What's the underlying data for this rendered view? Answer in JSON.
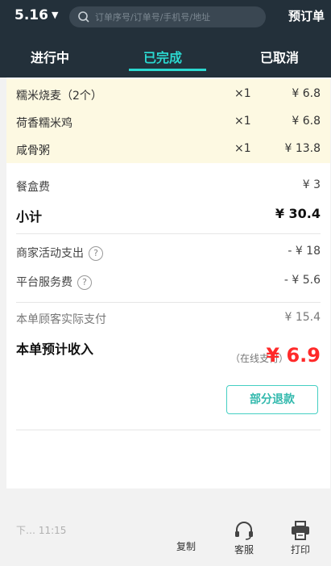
{
  "header": {
    "date": "5.16",
    "search_placeholder": "订单序号/订单号/手机号/地址",
    "order_button": "预订单"
  },
  "tabs": [
    {
      "label": "进行中"
    },
    {
      "label": "已完成"
    },
    {
      "label": "已取消"
    }
  ],
  "items": [
    {
      "name": "糯米烧麦（2个）",
      "qty": "×1",
      "price": "¥ 6.8"
    },
    {
      "name": "荷香糯米鸡",
      "qty": "×1",
      "price": "¥ 6.8"
    },
    {
      "name": "咸骨粥",
      "qty": "×1",
      "price": "¥ 13.8"
    }
  ],
  "fees": {
    "box_fee_label": "餐盒费",
    "box_fee_value": "¥ 3",
    "subtotal_label": "小计",
    "subtotal_value": "¥ 30.4",
    "merchant_promo_label": "商家活动支出",
    "merchant_promo_value": "- ¥ 18",
    "platform_fee_label": "平台服务费",
    "platform_fee_value": "- ¥ 5.6",
    "customer_paid_label": "本单顾客实际支付",
    "customer_paid_value": "¥ 15.4",
    "income_label": "本单预计收入",
    "online_pay_label": "（在线支付）",
    "income_value": "¥ 6.9"
  },
  "refund_button": "部分退款",
  "bottom": {
    "time_text": "下… 11:15",
    "copy_label": "复制",
    "service_label": "客服",
    "print_label": "打印"
  }
}
